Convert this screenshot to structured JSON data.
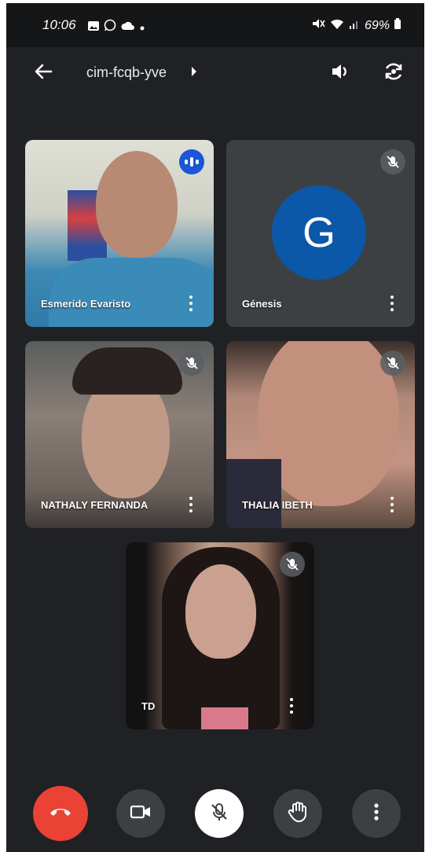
{
  "status_bar": {
    "time": "10:06",
    "battery": "69%"
  },
  "header": {
    "meeting_code": "cim-fcqb-yve"
  },
  "participants": [
    {
      "name": "Esmerido Evaristo",
      "state": "speaking"
    },
    {
      "name": "Génesis",
      "state": "muted",
      "avatar_letter": "G"
    },
    {
      "name": "NATHALY FERNANDA",
      "state": "muted"
    },
    {
      "name": "THALIA IBETH",
      "state": "muted"
    },
    {
      "name": "TD",
      "state": "muted"
    }
  ],
  "colors": {
    "background": "#202124",
    "end_call": "#ea4335",
    "speaking_badge": "#1a56d6",
    "avatar": "#0b57a8",
    "control_button": "#3c4043"
  },
  "controls": [
    "end-call",
    "camera",
    "microphone-muted",
    "raise-hand",
    "more-options"
  ]
}
